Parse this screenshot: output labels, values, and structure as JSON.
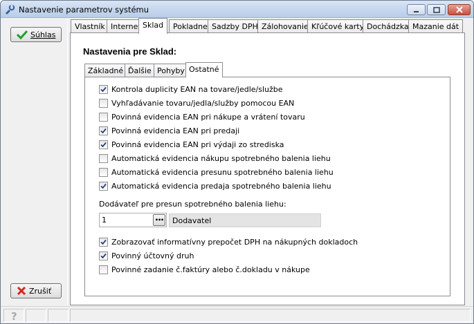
{
  "window": {
    "title": "Nastavenie parametrov systému"
  },
  "left_panel": {
    "ok_label": "Súhlas",
    "cancel_label": "Zrušiť"
  },
  "tabs": [
    {
      "label": "Vlastník"
    },
    {
      "label": "Internet"
    },
    {
      "label": "Sklad"
    },
    {
      "label": "Pokladne"
    },
    {
      "label": "Sadzby DPH"
    },
    {
      "label": "Zálohovanie"
    },
    {
      "label": "Kľúčové karty"
    },
    {
      "label": "Dochádzka"
    },
    {
      "label": "Mazanie dát"
    }
  ],
  "active_tab": "Sklad",
  "section_title": "Nastavenia pre Sklad:",
  "subtabs": [
    {
      "label": "Základné"
    },
    {
      "label": "Ďalšie"
    },
    {
      "label": "Pohyby"
    },
    {
      "label": "Ostatné"
    }
  ],
  "active_subtab": "Ostatné",
  "checkboxes_top": [
    {
      "label": "Kontrola duplicity EAN na tovare/jedle/službe",
      "checked": true
    },
    {
      "label": "Vyhľadávanie tovaru/jedla/služby pomocou EAN",
      "checked": false
    },
    {
      "label": "Povinná evidencia EAN pri nákupe a vrátení tovaru",
      "checked": false
    },
    {
      "label": "Povinná evidencia EAN pri predaji",
      "checked": true
    },
    {
      "label": "Povinná evidencia EAN pri výdaji zo strediska",
      "checked": true
    },
    {
      "label": "Automatická evidencia nákupu spotrebného balenia liehu",
      "checked": false
    },
    {
      "label": "Automatická evidencia presunu spotrebného balenia liehu",
      "checked": false
    },
    {
      "label": "Automatická evidencia predaja spotrebného balenia liehu",
      "checked": true
    }
  ],
  "supplier": {
    "label": "Dodávateľ pre presun spotrebného balenia liehu:",
    "value": "1",
    "browse_label": "•••",
    "name": "Dodavatel"
  },
  "checkboxes_bottom": [
    {
      "label": "Zobrazovať informatívny prepočet DPH na nákupných dokladoch",
      "checked": true
    },
    {
      "label": "Povinný účtovný druh",
      "checked": true
    },
    {
      "label": "Povinné zadanie č.faktúry alebo č.dokladu v nákupe",
      "checked": false
    }
  ],
  "statusbar": {
    "help_icon": "question-icon"
  }
}
